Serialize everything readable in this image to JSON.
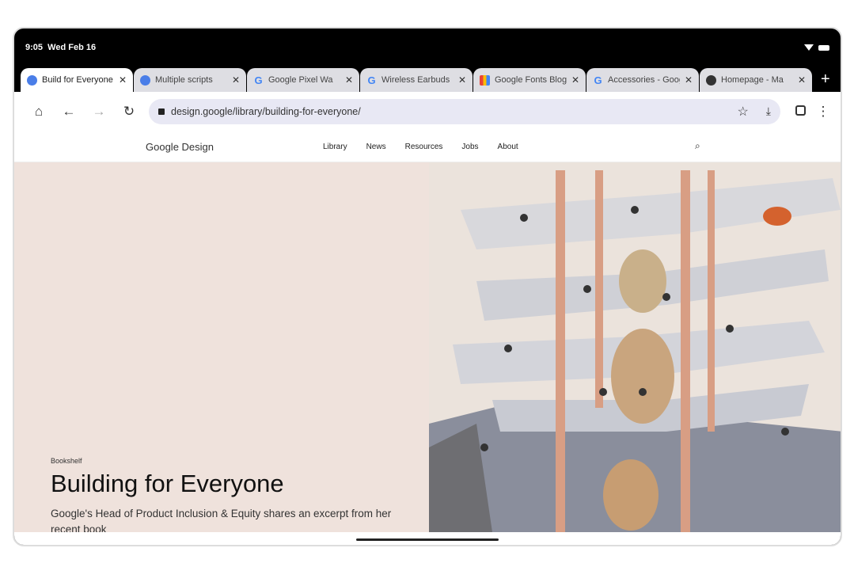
{
  "status": {
    "time": "9:05",
    "date": "Wed Feb 16"
  },
  "tabs": [
    {
      "label": "Build for Everyone",
      "icon": "gd"
    },
    {
      "label": "Multiple scripts",
      "icon": "gd"
    },
    {
      "label": "Google Pixel Wa",
      "icon": "g"
    },
    {
      "label": "Wireless Earbuds",
      "icon": "g"
    },
    {
      "label": "Google Fonts Blog",
      "icon": "f"
    },
    {
      "label": "Accessories - Google",
      "icon": "g"
    },
    {
      "label": "Homepage - Ma",
      "icon": "h"
    }
  ],
  "toolbar": {
    "url": "design.google/library/building-for-everyone/"
  },
  "site": {
    "logo": "Google Design",
    "nav": [
      "Library",
      "News",
      "Resources",
      "Jobs",
      "About"
    ]
  },
  "hero": {
    "kicker": "Bookshelf",
    "title": "Building for Everyone",
    "description": "Google's Head of Product Inclusion & Equity shares an excerpt from her recent book"
  }
}
